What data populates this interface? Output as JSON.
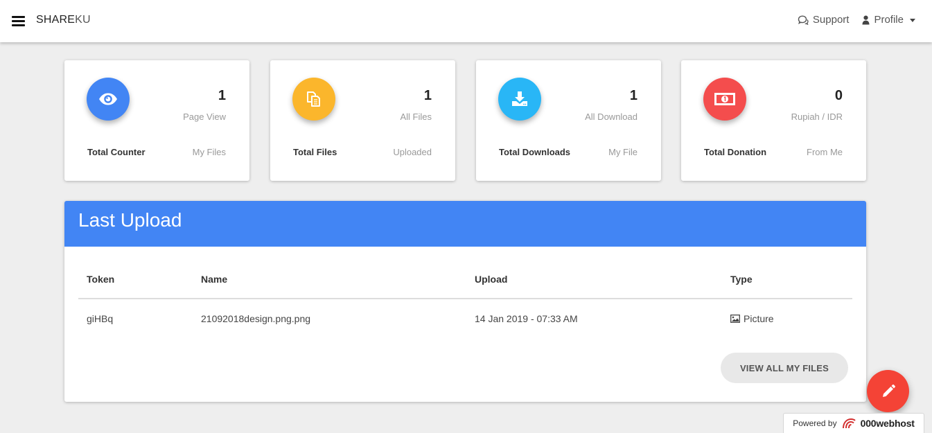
{
  "header": {
    "brand_part1": "SHARE",
    "brand_part2": "KU",
    "support_label": "Support",
    "profile_label": "Profile"
  },
  "cards": [
    {
      "value": "1",
      "sublabel": "Page View",
      "title": "Total Counter",
      "note": "My Files",
      "icon": "eye-icon",
      "color": "#4285f4"
    },
    {
      "value": "1",
      "sublabel": "All Files",
      "title": "Total Files",
      "note": "Uploaded",
      "icon": "files-icon",
      "color": "#fbb62c"
    },
    {
      "value": "1",
      "sublabel": "All Download",
      "title": "Total Downloads",
      "note": "My File",
      "icon": "download-icon",
      "color": "#29b6f6"
    },
    {
      "value": "0",
      "sublabel": "Rupiah / IDR",
      "title": "Total Donation",
      "note": "From Me",
      "icon": "money-icon",
      "color": "#f44d4d"
    }
  ],
  "panel": {
    "title": "Last Upload",
    "columns": [
      "Token",
      "Name",
      "Upload",
      "Type"
    ],
    "rows": [
      {
        "token": "giHBq",
        "name": "21092018design.png.png",
        "upload": "14 Jan 2019 - 07:33 AM",
        "type": "Picture",
        "type_icon": "image-icon"
      }
    ],
    "view_all_label": "VIEW ALL MY FILES"
  },
  "fab": {
    "icon": "pencil-icon",
    "color": "#f44336"
  },
  "footer": {
    "powered_label": "Powered by",
    "host_name": "000webhost"
  }
}
